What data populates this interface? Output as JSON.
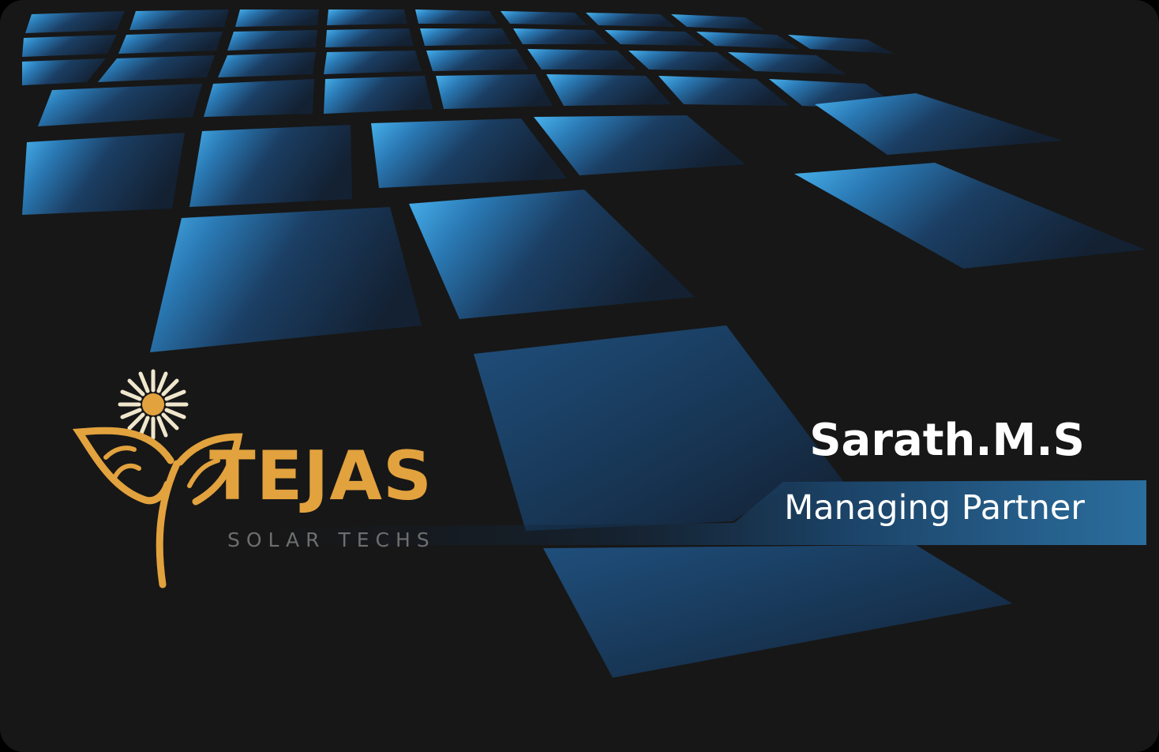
{
  "brand": {
    "name": "TEJAS",
    "tagline": "SOLAR TECHS",
    "accent_color": "#e2a23e"
  },
  "person": {
    "name": "Sarath.M.S",
    "title": "Managing Partner"
  },
  "colors": {
    "card_background": "#171717",
    "panel_blue": "#3aa3e0",
    "panel_dark_blue": "#1b3a5c"
  },
  "decorations": {
    "background": "solar-panel-grid",
    "logo_icon": "sun-flower-leaves-icon"
  }
}
